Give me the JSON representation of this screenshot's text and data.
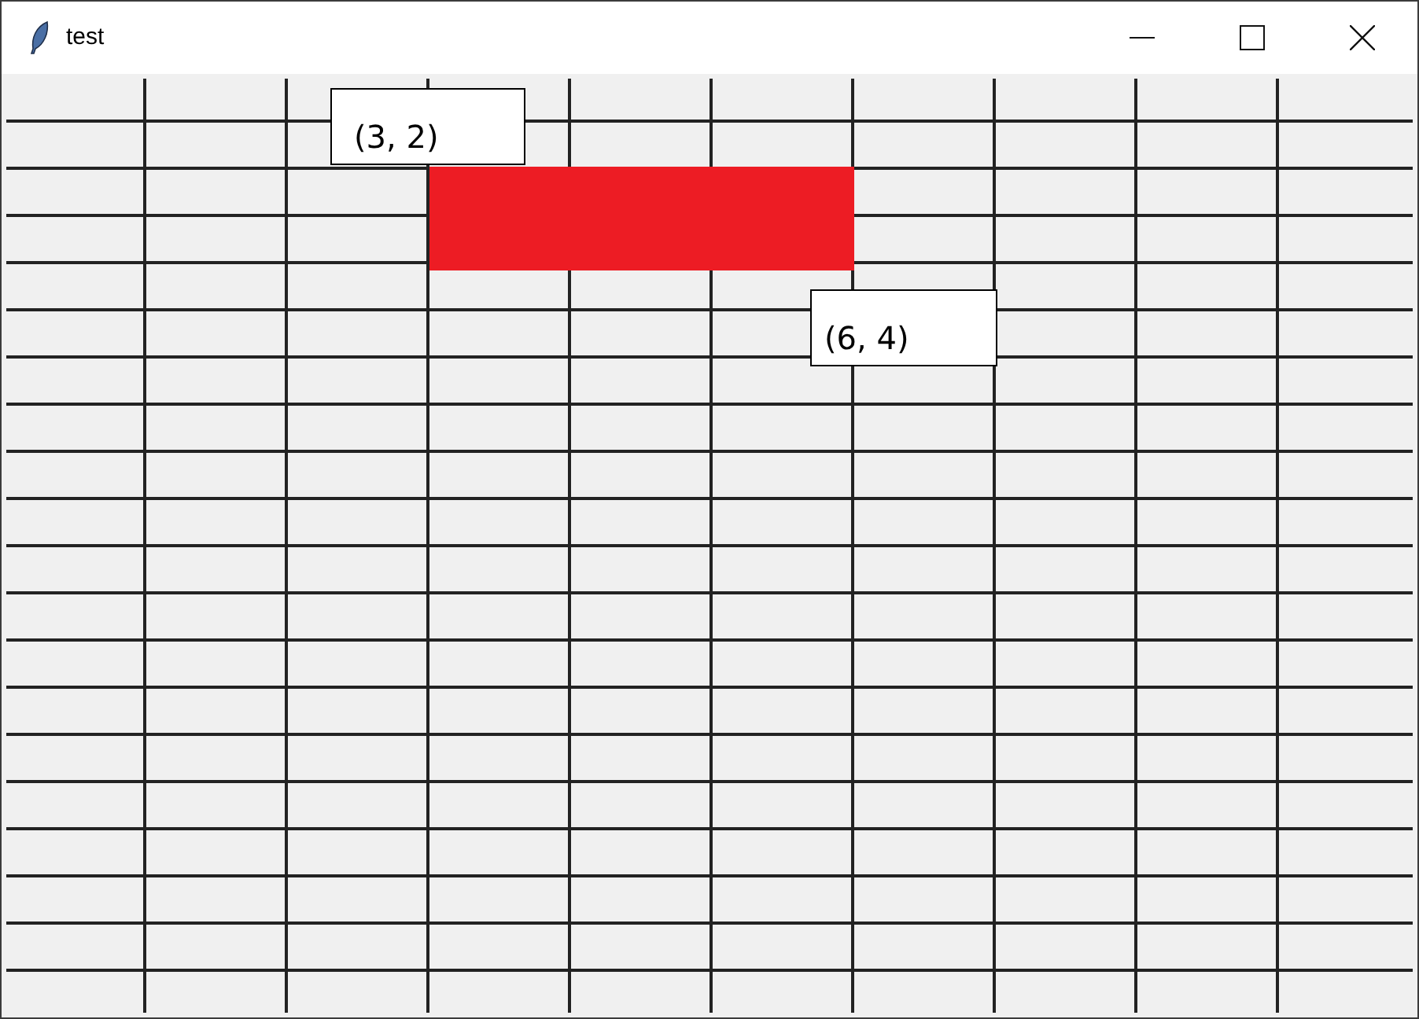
{
  "window": {
    "title": "test"
  },
  "canvas": {
    "labels": [
      {
        "text": "(3, 2)"
      },
      {
        "text": "(6, 4)"
      }
    ]
  }
}
